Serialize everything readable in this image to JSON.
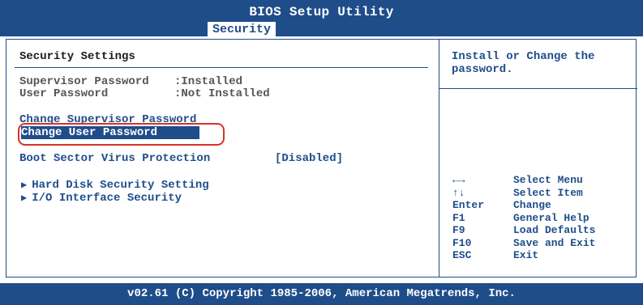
{
  "header": {
    "title": "BIOS Setup Utility",
    "active_tab": "Security"
  },
  "left": {
    "section_title": "Security Settings",
    "status": [
      {
        "label": "Supervisor Password",
        "value": ":Installed"
      },
      {
        "label": "User Password",
        "value": ":Not Installed"
      }
    ],
    "change_supervisor": "Change Supervisor Password",
    "change_user": "Change User Password",
    "boot_sector": {
      "label": "Boot Sector Virus Protection",
      "value": "[Disabled]"
    },
    "submenus": [
      "Hard Disk Security Setting",
      "I/O Interface Security"
    ]
  },
  "help": {
    "text_line1": "Install or Change the",
    "text_line2": "password.",
    "keys": [
      {
        "key": "←→",
        "desc": "Select Menu"
      },
      {
        "key": "↑↓",
        "desc": "Select Item"
      },
      {
        "key": "Enter",
        "desc": "Change"
      },
      {
        "key": "F1",
        "desc": "General Help"
      },
      {
        "key": "F9",
        "desc": "Load Defaults"
      },
      {
        "key": "F10",
        "desc": "Save and Exit"
      },
      {
        "key": "ESC",
        "desc": "Exit"
      }
    ]
  },
  "footer": {
    "copyright": "v02.61 (C) Copyright 1985-2006, American Megatrends, Inc."
  },
  "colors": {
    "bios_blue": "#1f4d8a",
    "highlight_box": "#d9312a"
  }
}
